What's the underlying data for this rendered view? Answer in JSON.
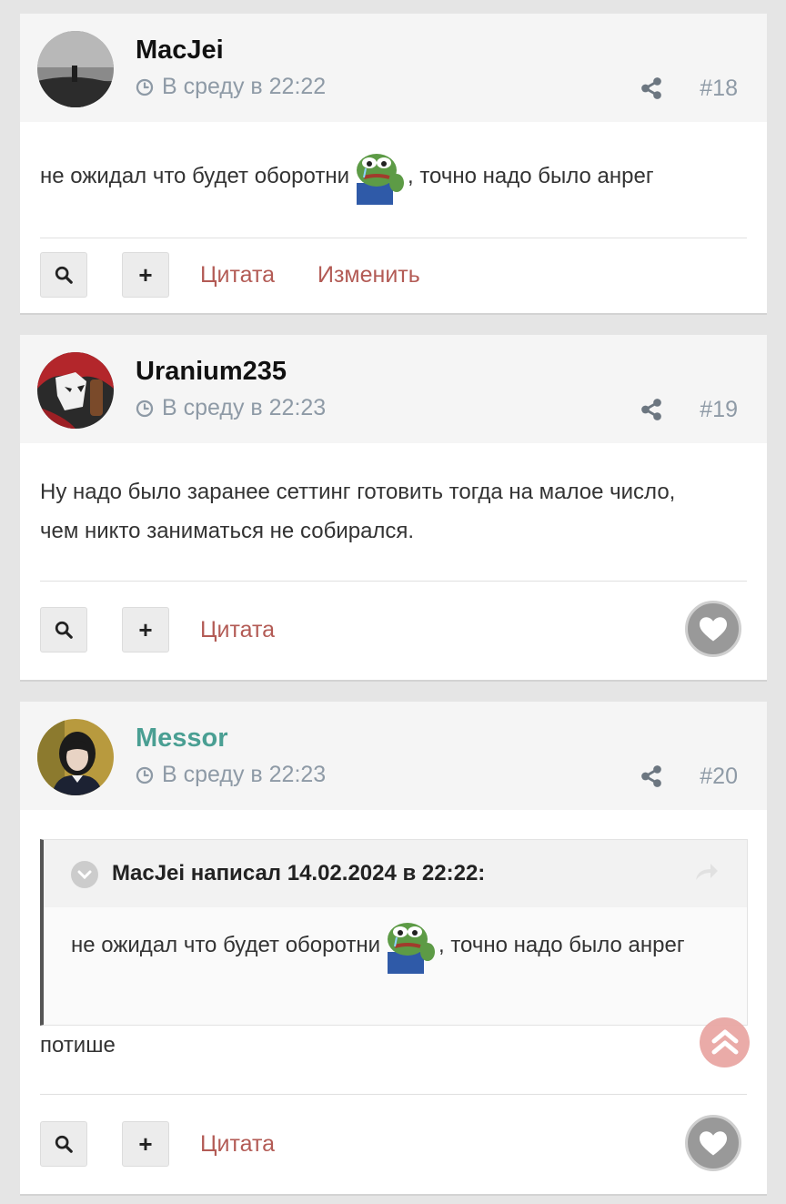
{
  "posts": [
    {
      "author": "MacJei",
      "date": "В среду в 22:22",
      "number": "#18",
      "body_before": "не ожидал что будет оборотни",
      "body_after": ", точно надо было анрег",
      "actions": {
        "quote": "Цитата",
        "edit": "Изменить"
      }
    },
    {
      "author": "Uranium235",
      "date": "В среду в 22:23",
      "number": "#19",
      "body": "Ну надо было заранее сеттинг готовить тогда на малое число, чем никто заниматься не собирался.",
      "actions": {
        "quote": "Цитата"
      }
    },
    {
      "author": "Messor",
      "date": "В среду в 22:23",
      "number": "#20",
      "quote": {
        "header": "MacJei написал 14.02.2024 в 22:22:",
        "text_before": "не ожидал что будет оборотни",
        "text_after": ", точно надо было анрег"
      },
      "body": "потише",
      "actions": {
        "quote": "Цитата"
      }
    }
  ],
  "icons": {
    "clock": "clock-icon",
    "share": "share-icon",
    "search": "search-icon",
    "plus": "plus-icon",
    "heart": "heart-icon",
    "scroll_top": "chevron-up-icon"
  },
  "colors": {
    "background": "#e5e5e5",
    "link": "#b35b55",
    "moderator_name": "#4a9f93",
    "meta": "#8e9aa6"
  }
}
